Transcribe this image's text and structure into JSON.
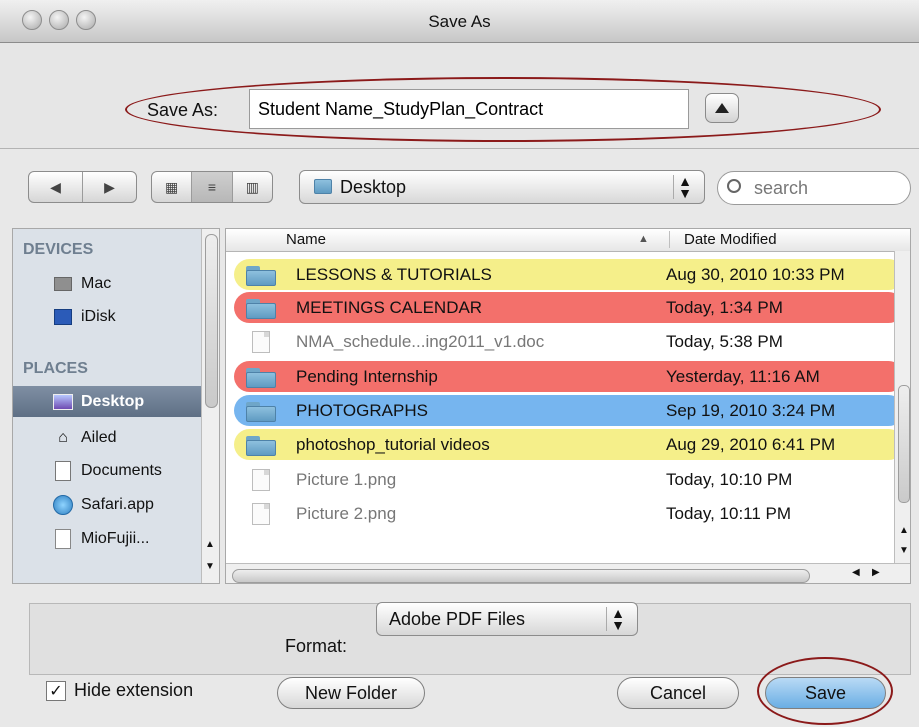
{
  "window": {
    "title": "Save As"
  },
  "save": {
    "label": "Save As:",
    "value": "Student Name_StudyPlan_Contract"
  },
  "location": {
    "current": "Desktop"
  },
  "search": {
    "placeholder": "search"
  },
  "sidebar": {
    "devices_header": "DEVICES",
    "places_header": "PLACES",
    "items": [
      {
        "label": "Mac",
        "icon": "hard-drive-icon"
      },
      {
        "label": "iDisk",
        "icon": "idisk-icon"
      },
      {
        "label": "Desktop",
        "icon": "desktop-icon",
        "selected": true
      },
      {
        "label": "Ailed",
        "icon": "home-icon"
      },
      {
        "label": "Documents",
        "icon": "documents-icon"
      },
      {
        "label": "Safari.app",
        "icon": "safari-icon"
      },
      {
        "label": "MioFujii...",
        "icon": "file-icon"
      }
    ]
  },
  "files": {
    "columns": [
      "Name",
      "Date Modified"
    ],
    "rows": [
      {
        "name": "LESSONS & TUTORIALS",
        "date": "Aug 30, 2010 10:33 PM",
        "type": "folder",
        "label_color": "#f5ef8a"
      },
      {
        "name": "MEETINGS CALENDAR",
        "date": "Today, 1:34 PM",
        "type": "folder",
        "label_color": "#f3706b"
      },
      {
        "name": "NMA_schedule...ing2011_v1.doc",
        "date": "Today, 5:38 PM",
        "type": "file",
        "label_color": "#ffffff"
      },
      {
        "name": "Pending Internship",
        "date": "Yesterday, 11:16 AM",
        "type": "folder",
        "label_color": "#f3706b"
      },
      {
        "name": "PHOTOGRAPHS",
        "date": "Sep 19, 2010 3:24 PM",
        "type": "folder",
        "label_color": "#76b5ef"
      },
      {
        "name": "photoshop_tutorial videos",
        "date": "Aug 29, 2010 6:41 PM",
        "type": "folder",
        "label_color": "#f5ef8a"
      },
      {
        "name": "Picture 1.png",
        "date": "Today, 10:10 PM",
        "type": "file",
        "label_color": "#ffffff"
      },
      {
        "name": "Picture 2.png",
        "date": "Today, 10:11 PM",
        "type": "file",
        "label_color": "#ffffff"
      }
    ]
  },
  "format": {
    "label": "Format:",
    "value": "Adobe PDF Files"
  },
  "footer": {
    "hide_extension_label": "Hide extension",
    "hide_extension_checked": true,
    "new_folder": "New Folder",
    "cancel": "Cancel",
    "save": "Save"
  },
  "annotations": {
    "highlight_color": "#8b1a1a"
  }
}
